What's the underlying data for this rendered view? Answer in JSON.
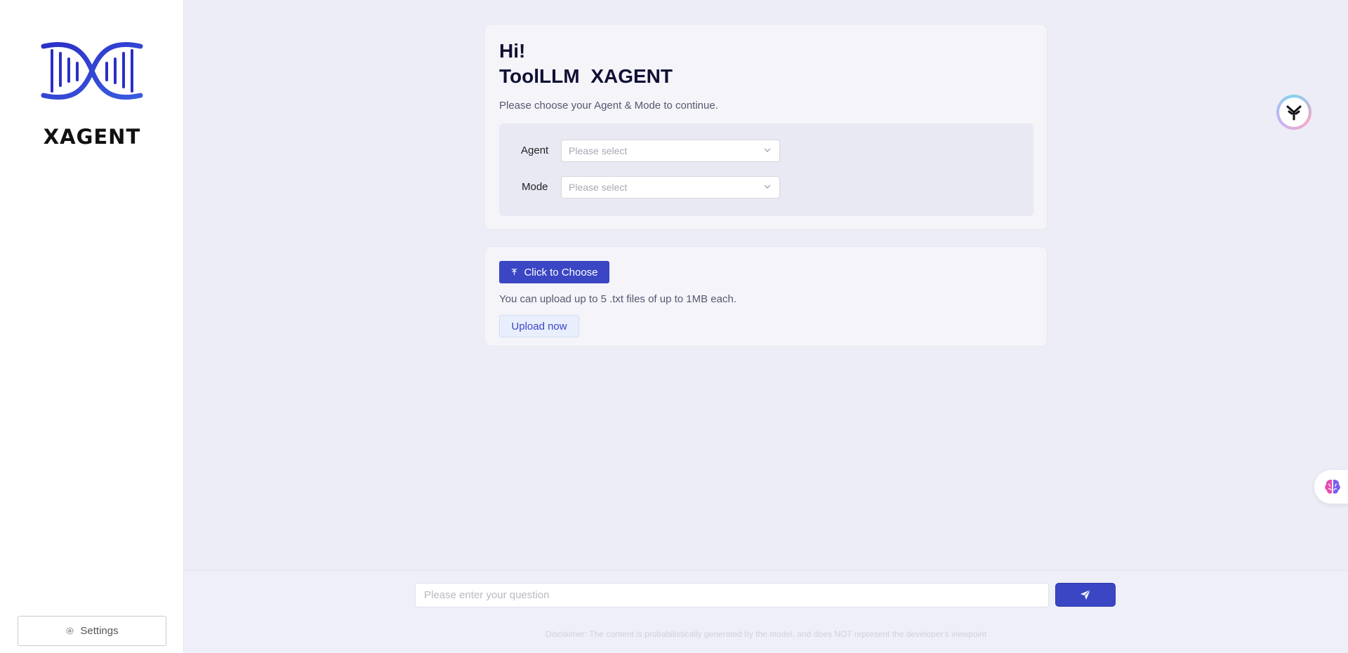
{
  "sidebar": {
    "logo_text": "XAGENT",
    "settings_label": "Settings"
  },
  "welcome": {
    "greeting": "Hi!",
    "title": "ToolLLM  XAGENT",
    "subtitle": "Please choose your Agent & Mode to continue.",
    "agent_label": "Agent",
    "agent_placeholder": "Please select",
    "mode_label": "Mode",
    "mode_placeholder": "Please select"
  },
  "upload": {
    "choose_label": "Click to Choose",
    "hint": "You can upload up to 5 .txt files of up to 1MB each.",
    "upload_now_label": "Upload now"
  },
  "chat": {
    "input_placeholder": "Please enter your question",
    "disclaimer": "Disclaimer: The content is probabilistically generated by the model, and does NOT represent the developer's viewpoint"
  },
  "colors": {
    "accent": "#3a46c4",
    "background": "#ecedf6",
    "sidebar": "#ffffff"
  },
  "icons": {
    "settings": "gear-icon",
    "upload": "upload-icon",
    "send": "paper-plane-icon",
    "chevron": "chevron-down-icon",
    "logo": "dna-logo-icon",
    "assistant": "assistant-avatar-icon",
    "brain": "brain-icon"
  }
}
